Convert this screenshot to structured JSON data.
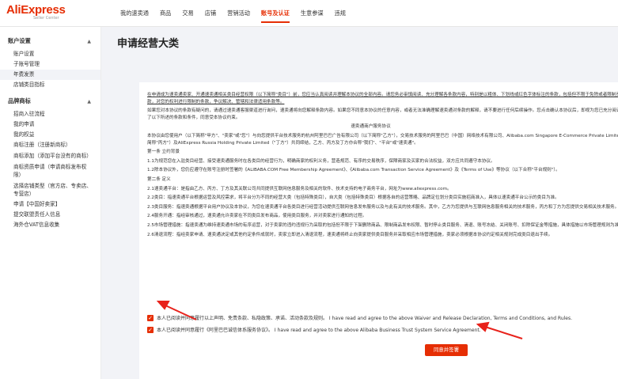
{
  "logo": {
    "brand": "AliExpress",
    "sub": "Seller Center"
  },
  "nav": {
    "items": [
      {
        "label": "我的速卖通",
        "active": false
      },
      {
        "label": "商品",
        "active": false
      },
      {
        "label": "交易",
        "active": false
      },
      {
        "label": "店铺",
        "active": false
      },
      {
        "label": "营销活动",
        "active": false
      },
      {
        "label": "账号及认证",
        "active": true
      },
      {
        "label": "生意参谋",
        "active": false
      },
      {
        "label": "违规",
        "active": false
      }
    ]
  },
  "sidebar": {
    "group1": {
      "title": "账户设置",
      "caret": "▲"
    },
    "group1_items": [
      "账户设置",
      "子账号管理",
      "年费发票",
      "店铺类目指标"
    ],
    "group2": {
      "title": "品牌商标",
      "caret": "▲"
    },
    "group2_items": [
      "招商入驻流程",
      "我的申请",
      "我的权益",
      "商标注册（注册新商标）",
      "商标添加（添加平台没有的商标）",
      "商标资质申请（申请商标发布权限）",
      "选择店铺类型（官方店、专卖店、专营店）",
      "申请【中国好卖家】",
      "提交联盟责任人信息",
      "海外仓VAT信息收集"
    ]
  },
  "main": {
    "title": "申请经营大类",
    "agreement": {
      "intro": "在申请成为速卖通卖家、开通速卖通相关类目经营权限（以下简称\"类目\"）前，您应当认真阅读并理解本协议的全部内容。请您务必审慎阅读、充分理解各条款内容，特别是以粗体、下划线或红色字体标注的条款，包括但不限于免除或者限制责任的条款，对您的权利进行限制的条款，争议解决、管辖和法律适用条款等。",
      "note": "如果您对本协议的条款有疑问的，请通过速卖通客服渠道进行询问，速卖通将向您解释条款内容。如果您不同意本协议的任意内容，或者无法准确理解速卖通对条款的解释，请不要进行任何后续操作。您点击确认本协议后，即视为您已充分阅读并理解了以下所述的条款和条件，同意受本协议约束。",
      "doc_title": "速卖通商户服务协议",
      "parties": "本协议由您使用户（以下简称\"甲方\"、\"卖家\"或\"您\"）与向您提供平台技术服务的杭州阿里巴巴广告有限公司（以下简称\"乙方\"），交易技术服务的阿里巴巴（中国）网络技术有限公司、Alibaba.com Singapore E-Commerce Private Limited（以下简称\"丙方\"）及AliExpress Russia Holding Private Limited（\"丁方\"）共同缔结，乙方、丙方及丁方亦合称\"我们\"、\"平台\"或\"速卖通\"。",
      "s1": "第一条 立约背景",
      "s1_1": "1.1为规范您在入驻类目经营、接受速卖通服务时在各类目的经营行为，明确商家的权利义务，营造规范、有序的交易秩序，保障商家及买家的合法权益，双方应共同遵守本协议。",
      "s1_2": "1.2除本协议外，您仍应遵守在账号注册时签署的《ALIBABA.COM Free Membership Agreement》、《Alibaba.com Transaction Service Agreement》及《Terms of Use》等协议（以下合称\"平台规则\"）。",
      "s2": "第二条 定义",
      "d2_1": "2.1速卖通平台：是指由乙方、丙方、丁方及其关联公司共同提供互联网信息服务及相关的软件、技术支持的电子商务平台，网址为www.aliexpress.com。",
      "d2_2": "2.2类目：指速卖通平台根据运营及风控需求，将平台分为不同的经营大类（包括特殊类目），自大类（包括特殊类目）根据各自的运营策略、品牌定位划分类目实施招商准入，具体以速卖通平台公示的类目为准。",
      "d2_3": "2.3类目服务：指速卖通根据平台用户协议及本协议，为您在速卖通平台各类目进行经营活动提供互联网信息发布服务以及与此有关的技术服务。其中，乙方为您提供与互联网信息服务相关的技术服务，丙方和丁方为您提供交易相关技术服务。",
      "d2_4": "2.4服务开通：指经审核通过，速卖通允许卖家在不同类目发布商品，使用类目服务，并对卖家进行通知的过程。",
      "d2_5": "2.5市场管理措施：指速卖通为维持速卖通市场的有序运营，对于卖家的违约违规行为采取的包括但不限于下架删除商品、限制商品发布权限、暂时停止类目服务、清退、账号冻结、关闭账号、扣除保证金等措施，具体措施以市场管理规则为准。",
      "d2_6": "2.6清退流程：指经卖家申请、速卖通决定或其他约定条件成就时，卖家立即进入清退流程，速卖通将终止向卖家提供类目服务并采取相应市场管理措施，卖家必须根据本协议约定相关规则完成类目退出手续。"
    },
    "check1_label": "本人已阅读并同意履行以上声明、免责条款、私隐政策、承诺、活动条款及规则。 I have read and agree to the above Waiver and Release Declaration, Terms and Conditions, and Rules.",
    "check2_label": "本人已阅读并同意履行《阿里巴巴诚信体系服务协议》。 I have read and agree to the above Alibaba Business Trust System Service Agreement.",
    "agree_button": "同意并签署"
  },
  "colors": {
    "accent": "#e62e04",
    "annotation": "#e8221b"
  }
}
